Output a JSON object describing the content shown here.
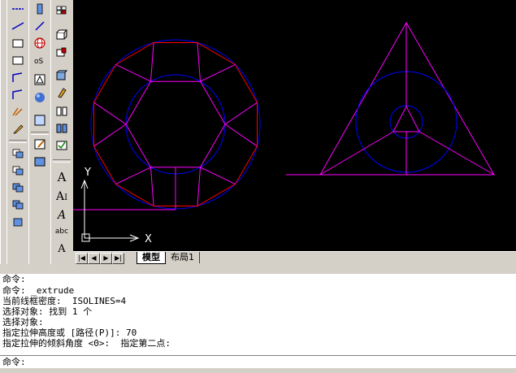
{
  "toolbars": {
    "left_column_1": [
      "line-icon",
      "pline-icon",
      "rectangle-icon",
      "arc-icon",
      "circle-icon",
      "spline-icon",
      "ellipse-icon",
      "insert-block-icon",
      "make-block-icon",
      "point-icon",
      "hatch-icon",
      "region-icon",
      "table-icon"
    ],
    "left_column_2": [
      "erase-icon",
      "copy-icon",
      "mirror-icon",
      "offset-icon",
      "array-icon",
      "move-icon",
      "rotate-icon",
      "scale-icon",
      "stretch-icon",
      "trim-icon",
      "extend-icon"
    ],
    "left_column_3": [
      "sphere-icon",
      "box-icon",
      "wedge-icon",
      "cylinder-icon",
      "cone-icon",
      "torus-icon",
      "extrude-icon",
      "revolve-icon",
      "text-icon",
      "mtext-icon",
      "style-icon"
    ]
  },
  "canvas": {
    "background": "#000000",
    "ucs": {
      "x_label": "X",
      "y_label": "Y"
    },
    "colors": {
      "magenta": "#ff00ff",
      "blue": "#0000ff",
      "red": "#ff0000"
    }
  },
  "tabs": {
    "model": "模型",
    "layout1": "布局1"
  },
  "command": {
    "history": [
      "命令:",
      "命令: _extrude",
      "当前线框密度:  ISOLINES=4",
      "选择对象: 找到 1 个",
      "选择对象:",
      "指定拉伸高度或 [路径(P)]: 70",
      "指定拉伸的倾斜角度 <0>:  指定第二点:"
    ],
    "prompt": "命令:"
  }
}
